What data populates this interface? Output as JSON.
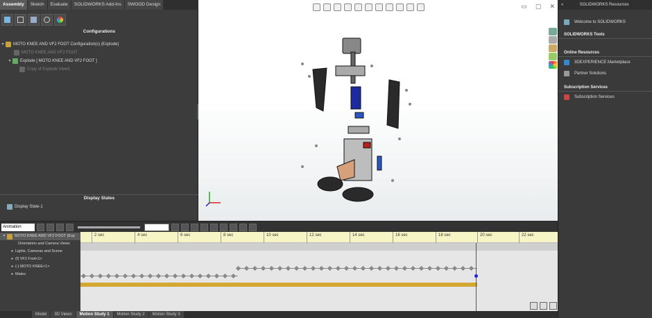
{
  "command_tabs": [
    "Assembly",
    "Sketch",
    "Evaluate",
    "SOLIDWORKS Add-Ins",
    "SWOOD Design"
  ],
  "active_command_tab": 0,
  "left_panel": {
    "configurations_header": "Configurations",
    "tree": [
      {
        "label": "MOTO KNEE AND VF2 FOOT Configuration(s)  (Explode)",
        "level": 0,
        "dim": false
      },
      {
        "label": "MOTO KNEE AND VF2 FOOT",
        "level": 1,
        "dim": true
      },
      {
        "label": "Explode [ MOTO KNEE AND VF2 FOOT ]",
        "level": 1,
        "dim": false
      },
      {
        "label": "Copy of Explode View1",
        "level": 2,
        "dim": true
      }
    ],
    "display_states_header": "Display States",
    "display_state": "Display State-1"
  },
  "right_panel": {
    "title": "SOLIDWORKS Resources",
    "welcome": "Welcome to SOLIDWORKS",
    "tools_header": "SOLIDWORKS Tools",
    "online_header": "Online Resources",
    "online_items": [
      "3DEXPERIENCE Marketplace",
      "Partner Solutions"
    ],
    "subscription_header": "Subscription Services",
    "subscription_items": [
      "Subscription Services"
    ]
  },
  "motion": {
    "study_type": "Animation",
    "time_labels": [
      "2 sec",
      "4 sec",
      "6 sec",
      "8 sec",
      "10 sec",
      "12 sec",
      "14 sec",
      "16 sec",
      "18 sec",
      "20 sec",
      "22 sec"
    ],
    "tree": [
      {
        "label": "MOTO KNEE AND VF2 FOOT (Exp",
        "dim": false
      },
      {
        "label": "Orientation and Camera Views",
        "dim": true
      },
      {
        "label": "Lights, Cameras and Scene",
        "dim": false
      },
      {
        "label": "(f) VF2 Foot<1>",
        "dim": false
      },
      {
        "label": "(-) MOTO KNEE<1>",
        "dim": false
      },
      {
        "label": "Mates",
        "dim": false
      }
    ]
  },
  "bottom_tabs": [
    "Model",
    "3D Views",
    "Motion Study 1",
    "Motion Study 2",
    "Motion Study 3"
  ],
  "active_bottom_tab": 2,
  "colors": {
    "accent": "#d4a632",
    "ruler": "#f5f5c6",
    "key": "#888888",
    "timebar": "#d4a632"
  }
}
